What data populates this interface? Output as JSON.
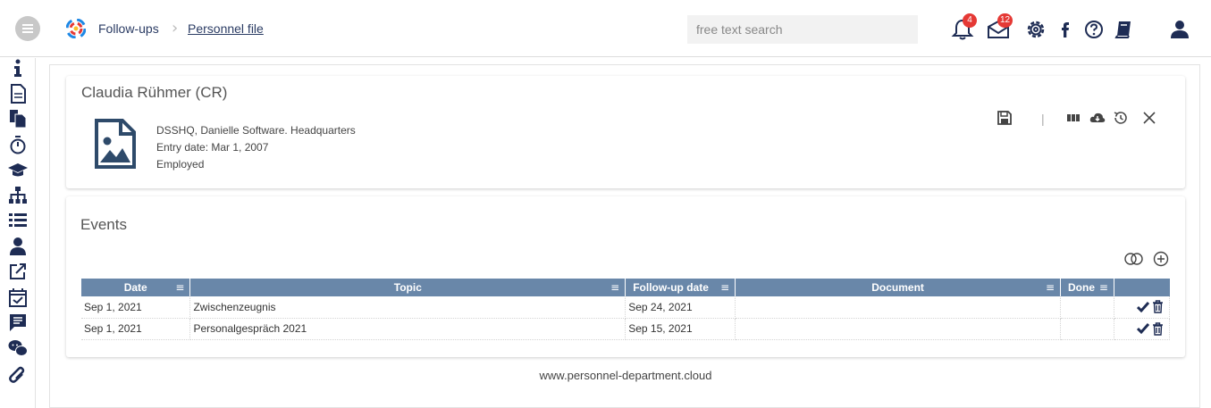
{
  "header": {
    "breadcrumb": [
      "Follow-ups",
      "Personnel file"
    ],
    "search": {
      "placeholder": "free text search",
      "value": ""
    },
    "notifications_count": "4",
    "messages_count": "12",
    "icons": [
      "bell-icon",
      "mail-icon",
      "gear-icon",
      "facebook-icon",
      "help-icon",
      "book-icon",
      "user-icon"
    ]
  },
  "sidebar": {
    "icons": [
      "info-icon",
      "document-icon",
      "documents-icon",
      "stopwatch-icon",
      "graduation-cap-icon",
      "org-chart-icon",
      "list-icon",
      "user-icon",
      "external-link-icon",
      "calendar-check-icon",
      "comment-list-icon",
      "chat-icon",
      "paperclip-icon"
    ]
  },
  "employee": {
    "name": "Claudia Rühmer (CR)",
    "company": "DSSHQ, Danielle Software. Headquarters",
    "entry_date": "Entry date: Mar 1, 2007",
    "status": "Employed"
  },
  "events": {
    "title": "Events",
    "columns": [
      "Date",
      "Topic",
      "Follow-up date",
      "Document",
      "Done"
    ],
    "rows": [
      {
        "date": "Sep 1, 2021",
        "topic": "Zwischenzeugnis",
        "followup": "Sep 24, 2021",
        "document": "",
        "done": ""
      },
      {
        "date": "Sep 1, 2021",
        "topic": "Personalgespräch 2021",
        "followup": "Sep 15, 2021",
        "document": "",
        "done": ""
      }
    ]
  },
  "footer": {
    "text": "www.personnel-department.cloud"
  },
  "colors": {
    "navy": "#1e2c54",
    "header_blue": "#6987a9",
    "badge_red": "#e53935"
  }
}
